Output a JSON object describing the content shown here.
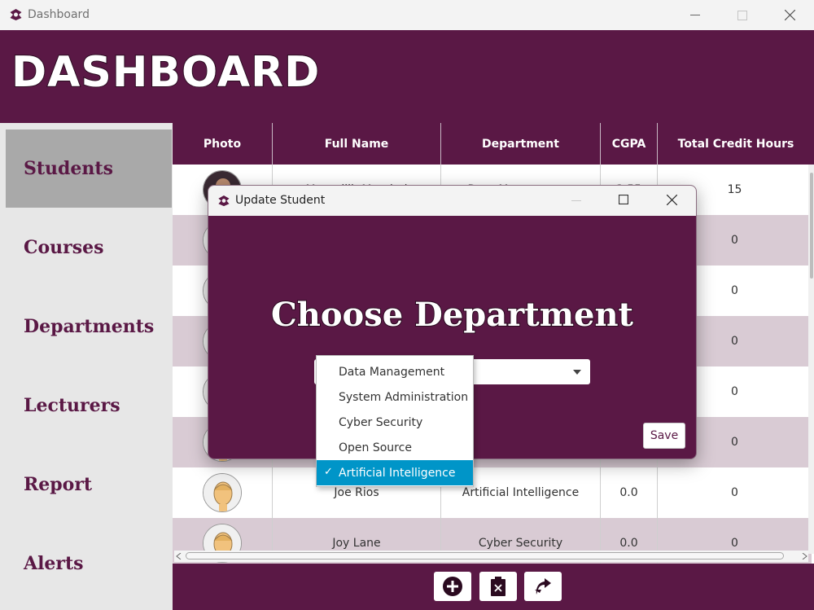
{
  "window": {
    "title": "Dashboard"
  },
  "header": {
    "title": "DASHBOARD"
  },
  "sidebar": {
    "items": [
      {
        "label": "Students",
        "active": true
      },
      {
        "label": "Courses"
      },
      {
        "label": "Departments"
      },
      {
        "label": "Lecturers"
      },
      {
        "label": "Report"
      },
      {
        "label": "Alerts"
      }
    ]
  },
  "table": {
    "columns": [
      "Photo",
      "Full Name",
      "Department",
      "CGPA",
      "Total Credit Hours"
    ],
    "rows": [
      {
        "name": "Muntallib Magdud",
        "department": "Data Management",
        "cgpa": "3.55",
        "credits": "15"
      },
      {
        "name": "",
        "department": "",
        "cgpa": "",
        "credits": "0"
      },
      {
        "name": "",
        "department": "",
        "cgpa": "",
        "credits": "0"
      },
      {
        "name": "",
        "department": "",
        "cgpa": "",
        "credits": "0"
      },
      {
        "name": "",
        "department": "",
        "cgpa": "",
        "credits": "0"
      },
      {
        "name": "",
        "department": "",
        "cgpa": "",
        "credits": "0"
      },
      {
        "name": "Joe Rios",
        "department": "Artificial Intelligence",
        "cgpa": "0.0",
        "credits": "0"
      },
      {
        "name": "Joy Lane",
        "department": "Cyber Security",
        "cgpa": "0.0",
        "credits": "0"
      }
    ]
  },
  "footer": {
    "buttons": [
      "add-icon",
      "delete-icon",
      "update-icon"
    ]
  },
  "dialog": {
    "title": "Update Student",
    "heading": "Choose Department",
    "save_label": "Save",
    "options": [
      "Data Management",
      "System Administration",
      "Cyber Security",
      "Open Source",
      "Artificial Intelligence"
    ],
    "selected": "Artificial Intelligence",
    "check": "✓"
  },
  "colors": {
    "brand": "#5a1845",
    "row_alt": "#d9cbd4",
    "selected": "#0095c8",
    "sidebar_active": "#a9a9a9"
  }
}
